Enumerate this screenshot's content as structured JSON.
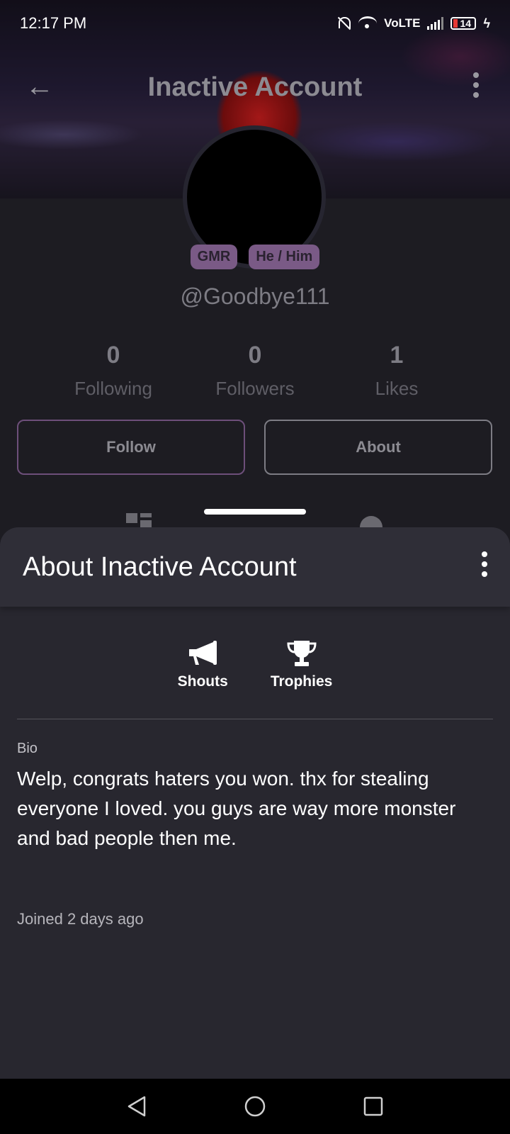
{
  "status_bar": {
    "time": "12:17 PM",
    "network": "VoLTE",
    "battery": "14"
  },
  "profile": {
    "title": "Inactive Account",
    "badges": [
      "GMR",
      "He / Him"
    ],
    "handle": "@Goodbye111",
    "stats": [
      {
        "value": "0",
        "label": "Following"
      },
      {
        "value": "0",
        "label": "Followers"
      },
      {
        "value": "1",
        "label": "Likes"
      }
    ],
    "follow_label": "Follow",
    "about_label": "About"
  },
  "sheet": {
    "title": "About Inactive Account",
    "tabs": [
      {
        "label": "Shouts",
        "icon": "megaphone-icon"
      },
      {
        "label": "Trophies",
        "icon": "trophy-icon"
      }
    ],
    "bio_label": "Bio",
    "bio_text": "Welp, congrats haters you won. thx for stealing everyone I loved. you guys are way more monster and bad people then me.",
    "joined": "Joined 2 days ago"
  },
  "colors": {
    "badge": "#7a5a86",
    "sheet_bg": "#28272f",
    "follow_border": "#6d4f7a"
  }
}
